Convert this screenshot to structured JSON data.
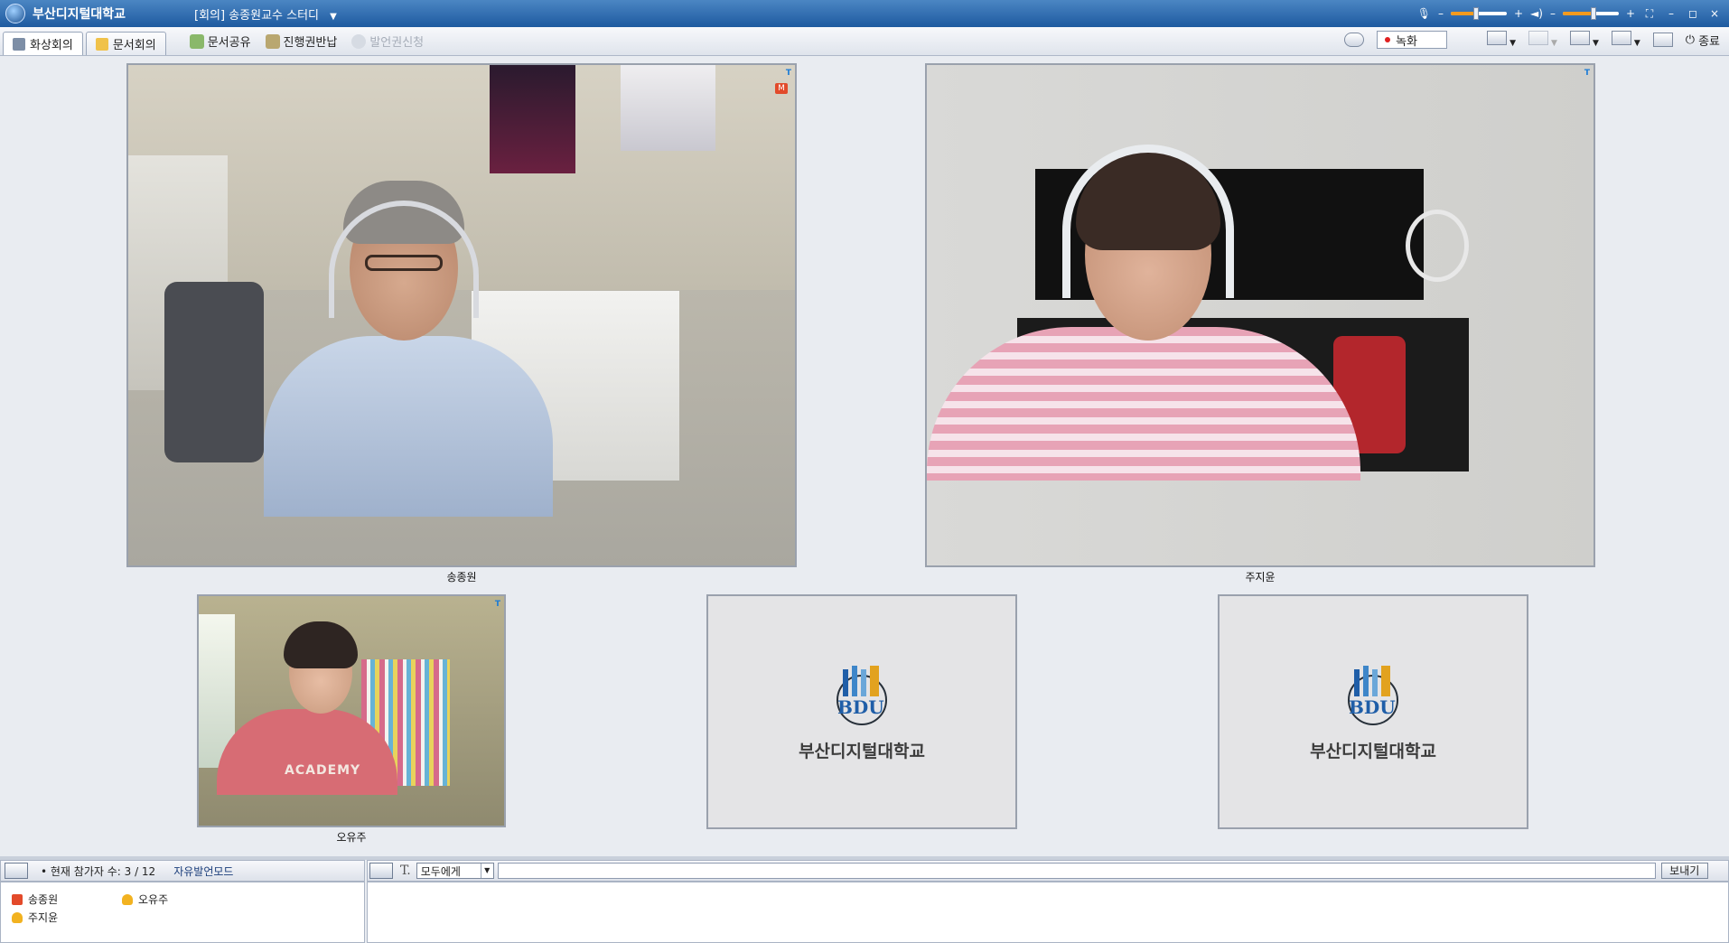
{
  "app": {
    "title": "부산디지털대학교",
    "meeting_title": "[회의] 송종원교수 스터디"
  },
  "window_controls": {
    "minimize": "–",
    "restore": "◻",
    "close": "×"
  },
  "tabs": [
    {
      "label": "화상회의"
    },
    {
      "label": "문서회의"
    }
  ],
  "tools": [
    {
      "label": "문서공유"
    },
    {
      "label": "진행권반납"
    },
    {
      "label": "발언권신청"
    }
  ],
  "toolbar_right": {
    "record_label": "녹화",
    "quit_label": "종료"
  },
  "volume": {
    "mic_level": 0.45,
    "speaker_level": 0.55
  },
  "videos": [
    {
      "name": "송종원",
      "badge": "T",
      "mic": "M"
    },
    {
      "name": "주지윤",
      "badge": "T"
    },
    {
      "name": "오유주",
      "badge": "T",
      "shirt_text": "ACADEMY"
    }
  ],
  "placeholders": [
    {
      "logo_text": "BDU",
      "school_name": "부산디지털대학교"
    },
    {
      "logo_text": "BDU",
      "school_name": "부산디지털대학교"
    }
  ],
  "participants": {
    "count_text": "• 현재 참가자 수: 3 / 12",
    "mode": "자유발언모드",
    "list": [
      {
        "name": "송종원",
        "role": "host"
      },
      {
        "name": "오유주",
        "role": "guest"
      },
      {
        "name": "주지윤",
        "role": "guest"
      }
    ]
  },
  "chat": {
    "target": "모두에게",
    "input_value": "",
    "send_label": "보내기"
  },
  "colors": {
    "title_bar": "#1e5aa0",
    "accent": "#f39a1e",
    "host_badge": "#e34a2a"
  }
}
